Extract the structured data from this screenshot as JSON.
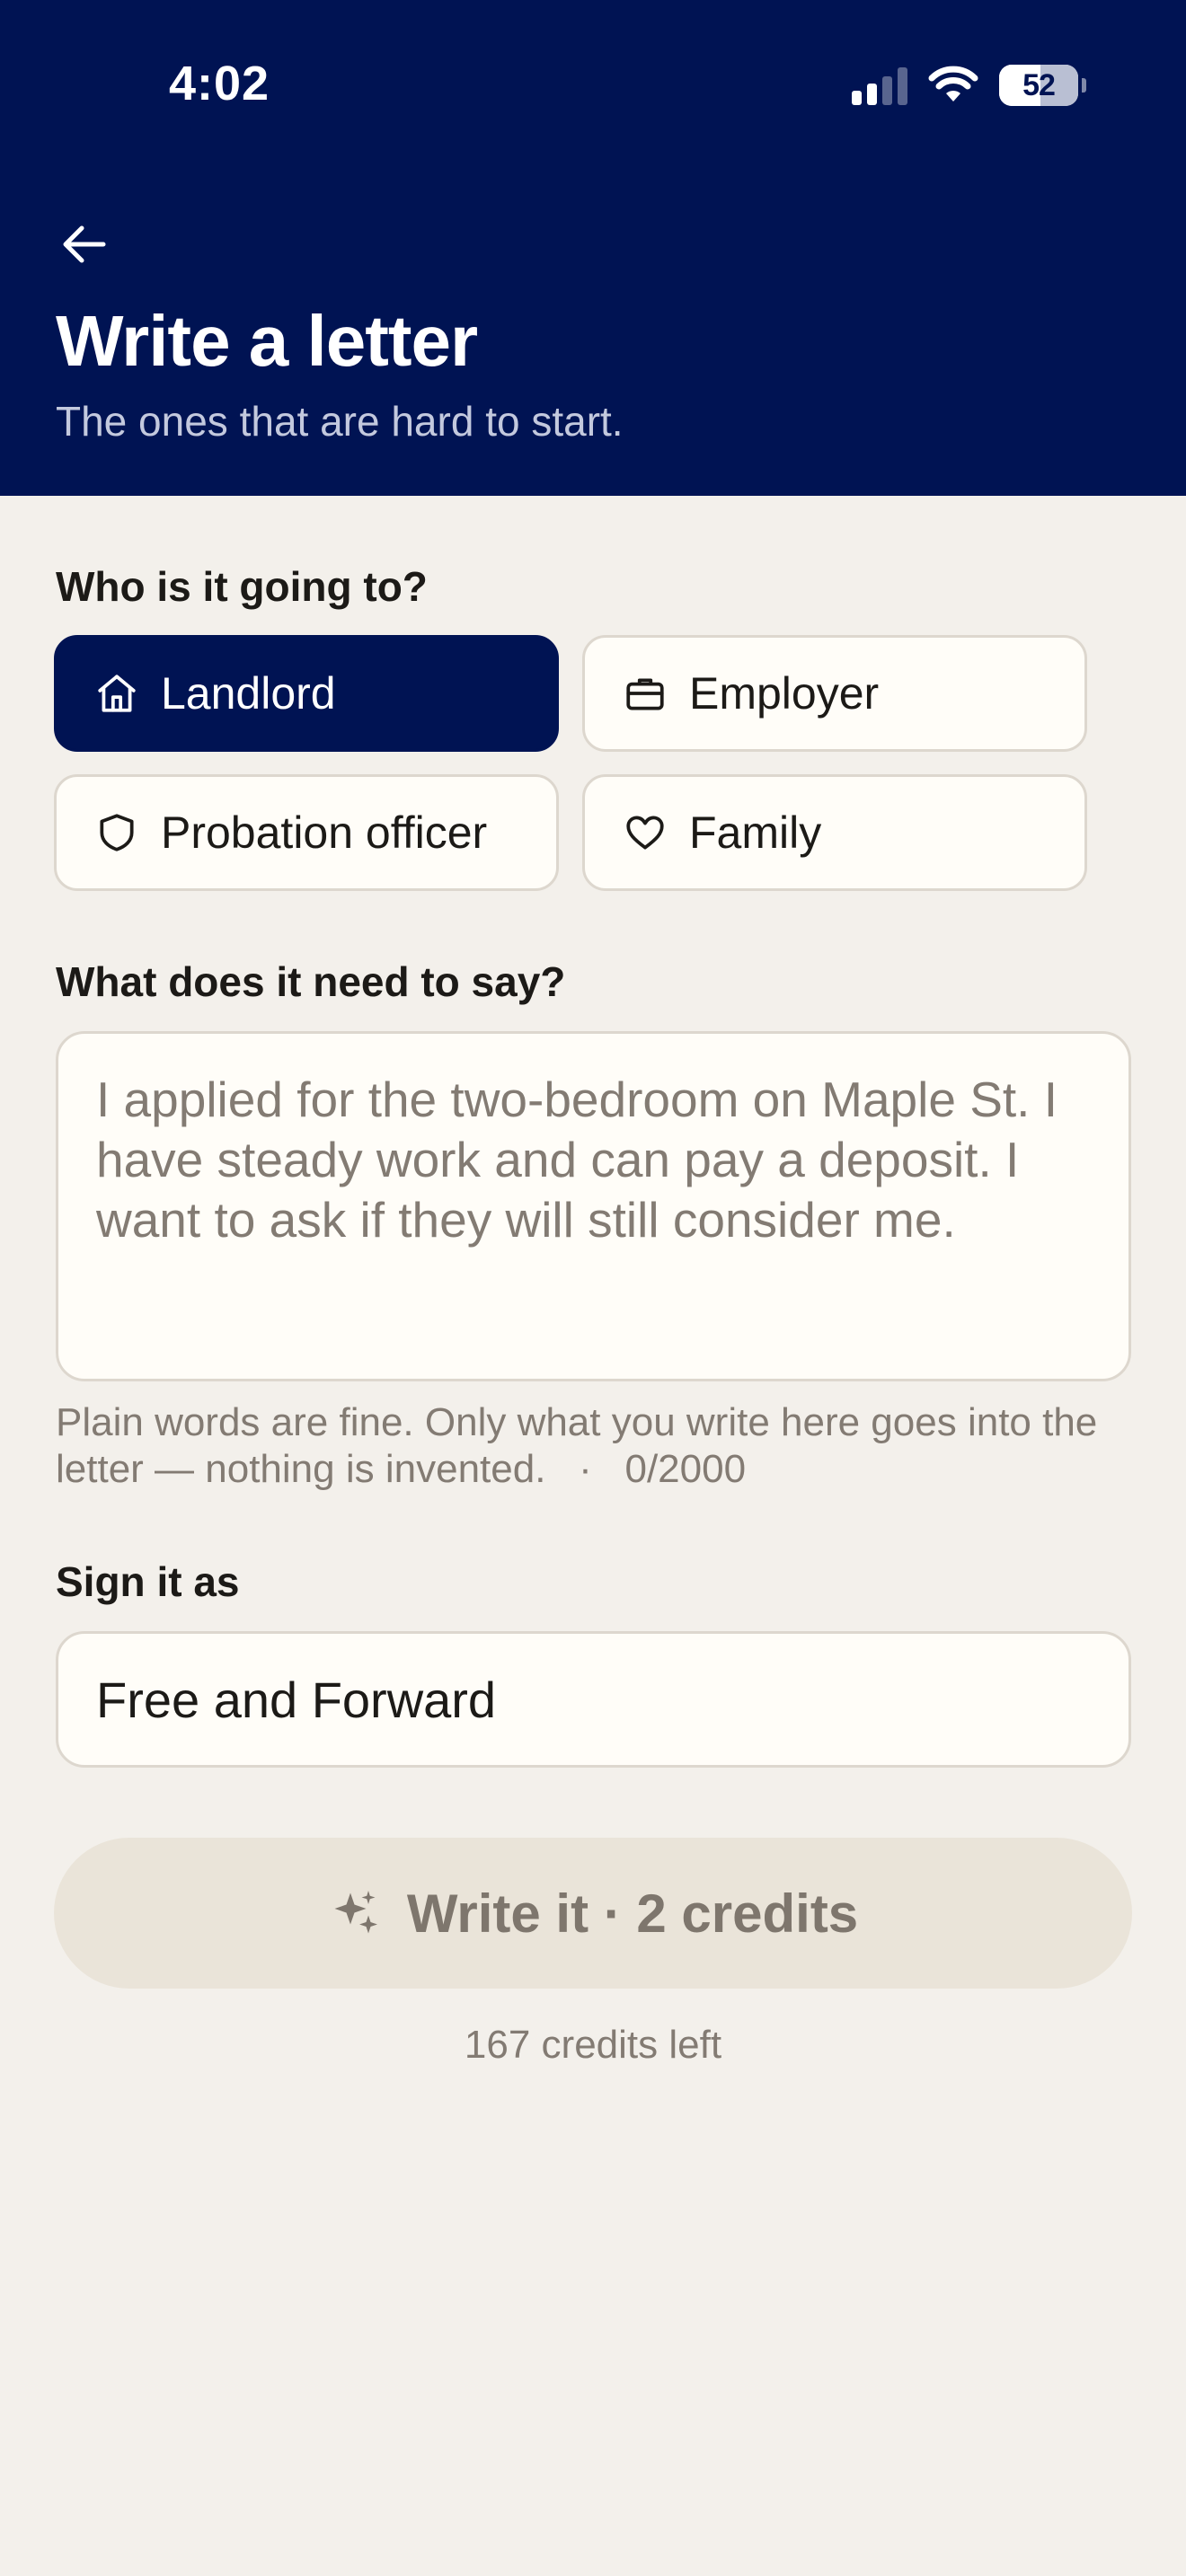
{
  "status_bar": {
    "time": "4:02",
    "battery": "52",
    "battery_level": 0.52,
    "signal_bars_active": 2
  },
  "header": {
    "title": "Write a letter",
    "subtitle": "The ones that are hard to start.",
    "back_icon": "arrow-left-icon",
    "background_color": "#001353"
  },
  "recipient": {
    "label": "Who is it going to?",
    "options": [
      {
        "label": "Landlord",
        "icon": "home-icon",
        "selected": true
      },
      {
        "label": "Employer",
        "icon": "briefcase-icon",
        "selected": false
      },
      {
        "label": "Probation officer",
        "icon": "shield-icon",
        "selected": false
      },
      {
        "label": "Family",
        "icon": "heart-icon",
        "selected": false
      }
    ]
  },
  "message": {
    "label": "What does it need to say?",
    "placeholder": "I applied for the two-bedroom on Maple St. I have steady work and can pay a deposit. I want to ask if they will still consider me.",
    "value": "",
    "help_text": "Plain words are fine. Only what you write here goes into the letter — nothing is invented.",
    "counter": "0/2000"
  },
  "signature": {
    "label": "Sign it as",
    "value": "Free and Forward"
  },
  "submit": {
    "label": "Write it · 2 credits",
    "icon": "sparkles-icon",
    "enabled": false
  },
  "credits_left": "167 credits left",
  "colors": {
    "accent": "#001353",
    "background": "#F3F0EB",
    "muted_text": "#837B73",
    "disabled_button": "#EAE4D9"
  }
}
